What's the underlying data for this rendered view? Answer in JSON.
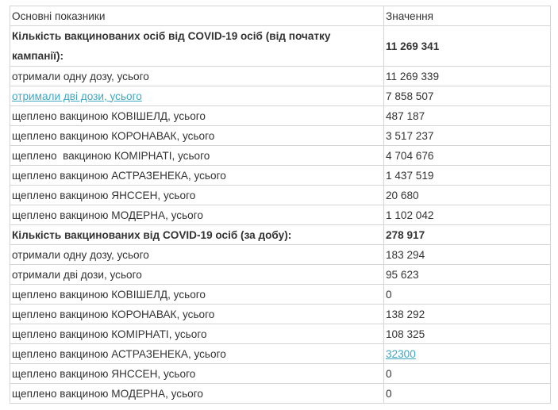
{
  "table": {
    "header": {
      "label": "Основні показники",
      "value": "Значення"
    },
    "rows": [
      {
        "label": "Кількість вакцинованих осіб від COVID-19 осіб (від початку кампанії):",
        "value": "11 269 341"
      },
      {
        "label": "отримали одну дозу, усього",
        "value": "11 269 339"
      },
      {
        "label": "отримали дві дози, усього",
        "value": "7 858 507"
      },
      {
        "label": "щеплено вакциною КОВІШЕЛД, усього",
        "value": "487 187"
      },
      {
        "label": "щеплено вакциною КОРОНАВАК, усього",
        "value": "3 517 237"
      },
      {
        "label": "щеплено  вакциною КОМІРНАТІ, усього",
        "value": "4 704 676"
      },
      {
        "label": "щеплено вакциною АСТРАЗЕНЕКА, усього",
        "value": "1 437 519"
      },
      {
        "label": "щеплено вакциною ЯНССЕН, усього",
        "value": "20 680"
      },
      {
        "label": "щеплено вакциною МОДЕРНА, усього",
        "value": "1 102 042"
      },
      {
        "label": "Кількість вакцинованих від COVID-19 осіб (за добу):",
        "value": "278 917"
      },
      {
        "label": "отримали одну дозу, усього",
        "value": "183 294"
      },
      {
        "label": "отримали дві дози, усього",
        "value": "95 623"
      },
      {
        "label": "щеплено вакциною КОВІШЕЛД, усього",
        "value": "0"
      },
      {
        "label": "щеплено вакциною КОРОНАВАК, усього",
        "value": "138 292"
      },
      {
        "label": "щеплено вакциною КОМІРНАТІ, усього",
        "value": "108 325"
      },
      {
        "label": "щеплено вакциною АСТРАЗЕНЕКА, усього",
        "value": "32300"
      },
      {
        "label": "щеплено вакциною ЯНССЕН, усього",
        "value": "0"
      },
      {
        "label": "щеплено вакциною МОДЕРНА, усього",
        "value": "0"
      }
    ]
  },
  "colors": {
    "text": "#333333",
    "link": "#3ea7c2",
    "border": "#d4d4d4"
  },
  "chart_data": {
    "type": "table",
    "columns": [
      "Основні показники",
      "Значення"
    ],
    "rows": [
      [
        "Кількість вакцинованих осіб від COVID-19 осіб (від початку кампанії):",
        "11 269 341"
      ],
      [
        "отримали одну дозу, усього",
        "11 269 339"
      ],
      [
        "отримали дві дози, усього",
        "7 858 507"
      ],
      [
        "щеплено вакциною КОВІШЕЛД, усього",
        "487 187"
      ],
      [
        "щеплено вакциною КОРОНАВАК, усього",
        "3 517 237"
      ],
      [
        "щеплено  вакциною КОМІРНАТІ, усього",
        "4 704 676"
      ],
      [
        "щеплено вакциною АСТРАЗЕНЕКА, усього",
        "1 437 519"
      ],
      [
        "щеплено вакциною ЯНССЕН, усього",
        "20 680"
      ],
      [
        "щеплено вакциною МОДЕРНА, усього",
        "1 102 042"
      ],
      [
        "Кількість вакцинованих від COVID-19 осіб (за добу):",
        "278 917"
      ],
      [
        "отримали одну дозу, усього",
        "183 294"
      ],
      [
        "отримали дві дози, усього",
        "95 623"
      ],
      [
        "щеплено вакциною КОВІШЕЛД, усього",
        "0"
      ],
      [
        "щеплено вакциною КОРОНАВАК, усього",
        "138 292"
      ],
      [
        "щеплено вакциною КОМІРНАТІ, усього",
        "108 325"
      ],
      [
        "щеплено вакциною АСТРАЗЕНЕКА, усього",
        "32300"
      ],
      [
        "щеплено вакциною ЯНССЕН, усього",
        "0"
      ],
      [
        "щеплено вакциною МОДЕРНА, усього",
        "0"
      ]
    ]
  }
}
